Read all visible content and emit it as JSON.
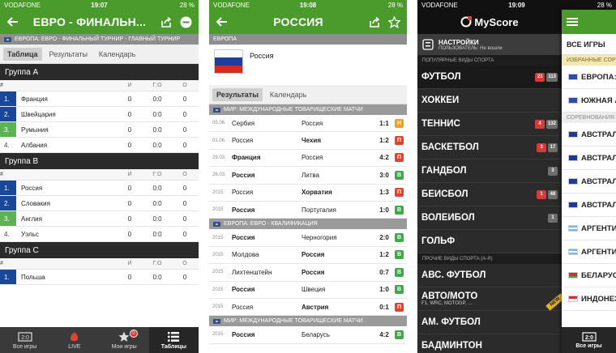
{
  "screen1": {
    "status": {
      "carrier": "VODAFONE",
      "time": "19:07",
      "battery": "28 %"
    },
    "title": "ЕВРО - ФИНАЛЬН...",
    "breadcrumb": "ЕВРОПА: ЕВРО - ФИНАЛЬНЫЙ ТУРНИР - ГЛАВНЫЙ ТУРНИР",
    "tabs": [
      "Таблица",
      "Результаты",
      "Календарь"
    ],
    "col_headers": {
      "rank": "#",
      "games": "И",
      "goals": "Г:О",
      "points": "О"
    },
    "groups": [
      {
        "name": "Группа A",
        "rows": [
          {
            "rank": "1.",
            "team": "Франция",
            "games": "0",
            "goals": "0:0",
            "points": "0",
            "zone": "blue"
          },
          {
            "rank": "2.",
            "team": "Швейцария",
            "games": "0",
            "goals": "0:0",
            "points": "0",
            "zone": "blue"
          },
          {
            "rank": "3.",
            "team": "Румыния",
            "games": "0",
            "goals": "0:0",
            "points": "0",
            "zone": "green"
          },
          {
            "rank": "4.",
            "team": "Албания",
            "games": "0",
            "goals": "0:0",
            "points": "0",
            "zone": "plain"
          }
        ]
      },
      {
        "name": "Группа B",
        "rows": [
          {
            "rank": "1.",
            "team": "Россия",
            "games": "0",
            "goals": "0:0",
            "points": "0",
            "zone": "blue"
          },
          {
            "rank": "2.",
            "team": "Словакия",
            "games": "0",
            "goals": "0:0",
            "points": "0",
            "zone": "blue"
          },
          {
            "rank": "3.",
            "team": "Англия",
            "games": "0",
            "goals": "0:0",
            "points": "0",
            "zone": "green"
          },
          {
            "rank": "4.",
            "team": "Уэльс",
            "games": "0",
            "goals": "0:0",
            "points": "0",
            "zone": "plain"
          }
        ]
      },
      {
        "name": "Группа C",
        "rows": [
          {
            "rank": "1.",
            "team": "Польша",
            "games": "0",
            "goals": "0:0",
            "points": "0",
            "zone": "blue"
          }
        ]
      }
    ],
    "nav": [
      {
        "label": "Все игры",
        "icon": "scoreboard-icon"
      },
      {
        "label": "LIVE",
        "icon": "flame-icon"
      },
      {
        "label": "Мои игры",
        "icon": "star-icon",
        "badge": "0"
      },
      {
        "label": "Таблицы",
        "icon": "list-icon"
      }
    ]
  },
  "screen2": {
    "status": {
      "carrier": "VODAFONE",
      "time": "19:08",
      "battery": "28 %"
    },
    "title": "РОССИЯ",
    "breadcrumb": "ЕВРОПА",
    "team_name": "Россия",
    "tabs": [
      "Результаты",
      "Календарь"
    ],
    "sections": [
      {
        "title": "МИР: МЕЖДУНАРОДНЫЕ ТОВАРИЩЕСКИЕ МАТЧИ",
        "matches": [
          {
            "date": "05.06.",
            "home": "Сербия",
            "away": "Россия",
            "score": "1:1",
            "result": "Н",
            "cls": "D",
            "bold": ""
          },
          {
            "date": "01.06.",
            "home": "Россия",
            "away": "Чехия",
            "score": "1:2",
            "result": "П",
            "cls": "L",
            "bold": "away"
          },
          {
            "date": "29.03.",
            "home": "Франция",
            "away": "Россия",
            "score": "4:2",
            "result": "П",
            "cls": "L",
            "bold": "home"
          },
          {
            "date": "26.03.",
            "home": "Россия",
            "away": "Литва",
            "score": "3:0",
            "result": "В",
            "cls": "W",
            "bold": "home"
          },
          {
            "date": "2015",
            "home": "Россия",
            "away": "Хорватия",
            "score": "1:3",
            "result": "П",
            "cls": "L",
            "bold": "away"
          },
          {
            "date": "2015",
            "home": "Россия",
            "away": "Португалия",
            "score": "1:0",
            "result": "В",
            "cls": "W",
            "bold": "home"
          }
        ]
      },
      {
        "title": "ЕВРОПА: ЕВРО - КВАЛИФИКАЦИЯ",
        "matches": [
          {
            "date": "2015",
            "home": "Россия",
            "away": "Черногория",
            "score": "2:0",
            "result": "В",
            "cls": "W",
            "bold": "home"
          },
          {
            "date": "2015",
            "home": "Молдова",
            "away": "Россия",
            "score": "1:2",
            "result": "В",
            "cls": "W",
            "bold": "away"
          },
          {
            "date": "2015",
            "home": "Лихтенштейн",
            "away": "Россия",
            "score": "0:7",
            "result": "В",
            "cls": "W",
            "bold": "away"
          },
          {
            "date": "2015",
            "home": "Россия",
            "away": "Швеция",
            "score": "1:0",
            "result": "В",
            "cls": "W",
            "bold": "home"
          },
          {
            "date": "2015",
            "home": "Россия",
            "away": "Австрия",
            "score": "0:1",
            "result": "П",
            "cls": "L",
            "bold": "away"
          }
        ]
      },
      {
        "title": "МИР: МЕЖДУНАРОДНЫЕ ТОВАРИЩЕСКИЕ МАТЧИ",
        "matches": [
          {
            "date": "2015",
            "home": "Россия",
            "away": "Беларусь",
            "score": "4:2",
            "result": "В",
            "cls": "W",
            "bold": "home"
          }
        ]
      }
    ]
  },
  "screen3": {
    "status": {
      "carrier": "VODAFONE",
      "time": "19:09",
      "battery": "28 %"
    },
    "logo": "MyScore",
    "settings": {
      "title": "НАСТРОЙКИ",
      "subtitle": "ПОЛЬЗОВАТЕЛЬ: Не вошли"
    },
    "popular_header": "ПОПУЛЯРНЫЕ ВИДЫ СПОРТА",
    "popular": [
      {
        "name": "ФУТБОЛ",
        "live": "21",
        "total": "113",
        "active": true
      },
      {
        "name": "ХОККЕЙ",
        "live": "",
        "total": ""
      },
      {
        "name": "ТЕННИС",
        "live": "4",
        "total": "132"
      },
      {
        "name": "БАСКЕТБОЛ",
        "live": "3",
        "total": "17"
      },
      {
        "name": "ГАНДБОЛ",
        "live": "",
        "total": "3"
      },
      {
        "name": "БЕЙСБОЛ",
        "live": "1",
        "total": "48"
      },
      {
        "name": "ВОЛЕЙБОЛ",
        "live": "",
        "total": "1"
      },
      {
        "name": "ГОЛЬФ",
        "live": "",
        "total": ""
      }
    ],
    "other_header": "ПРОЧИЕ ВИДЫ СПОРТА (А-Я)",
    "other": [
      {
        "name": "АВС. ФУТБОЛ",
        "sub": ""
      },
      {
        "name": "АВТО/МОТО",
        "sub": "F1, WRC, MOTOGP, ...",
        "ribbon": "NEW"
      },
      {
        "name": "АМ. ФУТБОЛ",
        "sub": ""
      },
      {
        "name": "БАДМИНТОН",
        "sub": ""
      }
    ],
    "peek": {
      "all_games": "ВСЕ ИГРЫ",
      "fav_header": "ИЗБРАННЫЕ СОРЕВНОВАНИЯ",
      "fav": [
        {
          "name": "ЕВРОПА: ЕВРО",
          "flag": "eu"
        },
        {
          "name": "ЮЖНАЯ АМЕРИКА",
          "flag": "eu"
        }
      ],
      "comp_header": "СОРЕВНОВАНИЯ",
      "countries": [
        {
          "name": "АВСТРАЛИЯ",
          "flag": "au"
        },
        {
          "name": "АВСТРАЛИЯ",
          "flag": "au"
        },
        {
          "name": "АВСТРАЛИЯ",
          "flag": "au"
        },
        {
          "name": "АВСТРАЛИЯ",
          "flag": "au"
        },
        {
          "name": "АРГЕНТИНА",
          "flag": "ar"
        },
        {
          "name": "АРГЕНТИНА",
          "flag": "ar"
        },
        {
          "name": "БЕЛАРУСЬ",
          "flag": "by"
        },
        {
          "name": "ИНДОНЕЗИЯ",
          "flag": "id"
        }
      ],
      "nav_label": "Все игры"
    }
  },
  "colors": {
    "brand_green": "#4b9a2c",
    "dark": "#2b2b2b",
    "live_red": "#d63a3a",
    "qual_blue": "#19479a",
    "qual_green": "#5bb353"
  }
}
